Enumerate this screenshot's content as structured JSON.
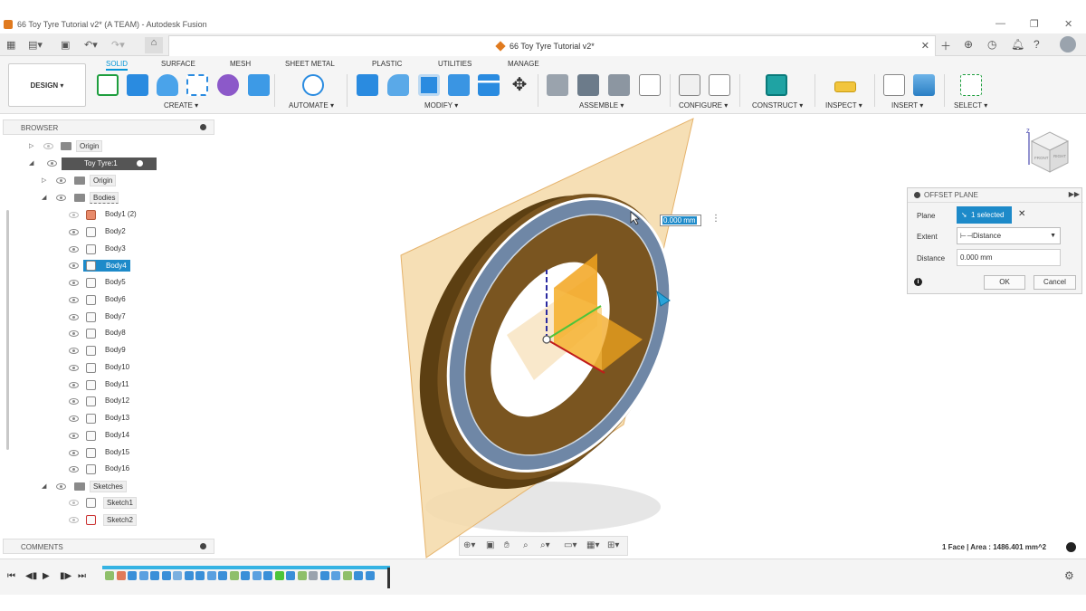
{
  "window": {
    "title": "66 Toy Tyre Tutorial v2* (A TEAM) - Autodesk Fusion"
  },
  "document_tab": {
    "title": "66 Toy Tyre Tutorial v2*"
  },
  "ribbon": {
    "workspace": "DESIGN",
    "tabs": [
      "SOLID",
      "SURFACE",
      "MESH",
      "SHEET METAL",
      "PLASTIC",
      "UTILITIES",
      "MANAGE"
    ],
    "groups": [
      "CREATE",
      "AUTOMATE",
      "MODIFY",
      "ASSEMBLE",
      "CONFIGURE",
      "CONSTRUCT",
      "INSPECT",
      "INSERT",
      "SELECT"
    ]
  },
  "browser": {
    "title": "BROWSER",
    "root_origin": "Origin",
    "component": "Toy Tyre:1",
    "component_origin": "Origin",
    "bodies_folder": "Bodies",
    "bodies": [
      "Body1 (2)",
      "Body2",
      "Body3",
      "Body4",
      "Body5",
      "Body6",
      "Body7",
      "Body8",
      "Body9",
      "Body10",
      "Body11",
      "Body12",
      "Body13",
      "Body14",
      "Body15",
      "Body16"
    ],
    "selected_body": "Body4",
    "sketches_folder": "Sketches",
    "sketches": [
      "Sketch1",
      "Sketch2"
    ]
  },
  "comments": {
    "title": "COMMENTS"
  },
  "viewport": {
    "distance_value": "0.000 mm"
  },
  "viewcube": {
    "front": "FRONT",
    "right": "RIGHT",
    "axis_z": "Z"
  },
  "offset_plane": {
    "title": "OFFSET PLANE",
    "plane_label": "Plane",
    "plane_value": "1 selected",
    "extent_label": "Extent",
    "extent_value": "Distance",
    "distance_label": "Distance",
    "distance_value": "0.000 mm",
    "ok_label": "OK",
    "cancel_label": "Cancel"
  },
  "status": {
    "text": "1 Face | Area : 1486.401 mm^2"
  },
  "colors": {
    "accent": "#0696d7",
    "selection": "#1d8ac9",
    "plane": "#f5d9a8",
    "tyre": "#6b4a17",
    "rim": "#6f87a6"
  }
}
